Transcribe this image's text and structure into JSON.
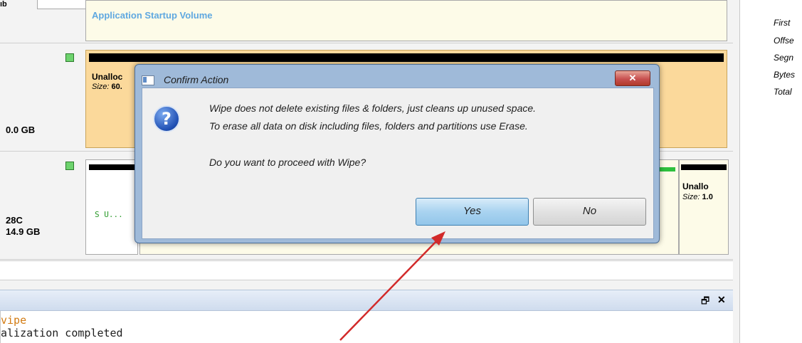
{
  "disks": [
    {
      "size_label": "",
      "partitions": [
        {
          "name": "Application Startup Volume",
          "size_prefix": "",
          "size": ""
        }
      ]
    },
    {
      "size_label": "0.0 GB",
      "partitions": [
        {
          "name": "Unalloc",
          "size_prefix": "Size:",
          "size": "60."
        }
      ]
    },
    {
      "size_label_line1": "28C",
      "size_label_line2": "14.9 GB",
      "partitions": [
        {
          "name": "",
          "system_label": "S U..."
        },
        {
          "name": "Unallo",
          "size_prefix": "Size:",
          "size": "1.0"
        }
      ]
    }
  ],
  "top_fragment": "ıb",
  "properties": [
    "First",
    "Offse",
    "Segn",
    "Bytes",
    "Total"
  ],
  "log_panel": {
    "pin_icon_glyph": "🗗",
    "close_glyph": "✕",
    "lines": [
      "vipe",
      "alization completed"
    ]
  },
  "dialog": {
    "title": "Confirm Action",
    "close_glyph": "✕",
    "icon_glyph": "?",
    "message_line1": "Wipe does not delete existing files & folders, just cleans up unused space.",
    "message_line2": "To erase all data on disk including files, folders and partitions use Erase.",
    "question": "Do you want to proceed with Wipe?",
    "yes_label": "Yes",
    "no_label": "No"
  },
  "colors": {
    "accent_text": "#5fa8e0",
    "log_highlight": "#d27b12",
    "system_label": "#2a9a2a",
    "arrow": "#d22a2a"
  }
}
